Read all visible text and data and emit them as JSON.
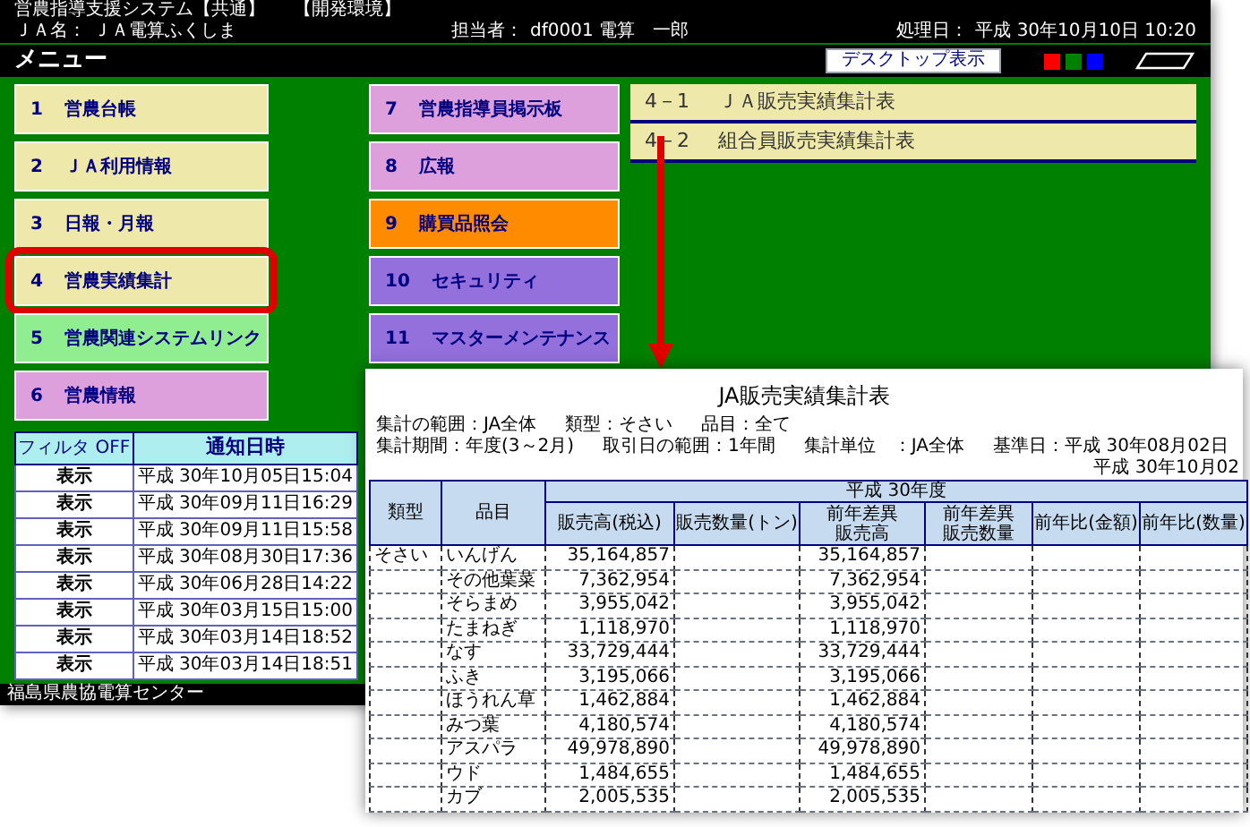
{
  "header": {
    "system_name": "営農指導支援システム【共通】",
    "environment": "【開発環境】",
    "ja_label": "ＪＡ名：",
    "ja_name": "ＪＡ電算ふくしま",
    "staff_label": "担当者：",
    "staff": "df0001 電算　一郎",
    "date_label": "処理日：",
    "date": "平成 30年10月10日 10:20"
  },
  "menu_bar": {
    "title": "メニュー",
    "desktop_button": "デスクトップ表示",
    "swatches": [
      {
        "color": "#ff0000"
      },
      {
        "color": "#008000"
      },
      {
        "color": "#0000ff"
      }
    ]
  },
  "menu": {
    "left_column": [
      {
        "number": "1",
        "label": "営農台帳",
        "color": "#eee8aa",
        "highlighted": false
      },
      {
        "number": "2",
        "label": "ＪＡ利用情報",
        "color": "#eee8aa",
        "highlighted": false
      },
      {
        "number": "3",
        "label": "日報・月報",
        "color": "#eee8aa",
        "highlighted": false
      },
      {
        "number": "4",
        "label": "営農実績集計",
        "color": "#eee8aa",
        "highlighted": true
      },
      {
        "number": "5",
        "label": "営農関連システムリンク",
        "color": "#90ee90",
        "highlighted": false
      },
      {
        "number": "6",
        "label": "営農情報",
        "color": "#dda0dd",
        "highlighted": false
      }
    ],
    "right_column": [
      {
        "number": "7",
        "label": "営農指導員掲示板",
        "color": "#dda0dd",
        "highlighted": false
      },
      {
        "number": "8",
        "label": "広報",
        "color": "#dda0dd",
        "highlighted": false
      },
      {
        "number": "9",
        "label": "購買品照会",
        "color": "#ff8c00",
        "highlighted": false
      },
      {
        "number": "10",
        "label": "セキュリティ",
        "color": "#9370db",
        "highlighted": false
      },
      {
        "number": "11",
        "label": "マスターメンテナンス",
        "color": "#9370db",
        "highlighted": false
      }
    ]
  },
  "submenu": [
    {
      "number": "4－1",
      "label": "ＪＡ販売実績集計表"
    },
    {
      "number": "4－2",
      "label": "組合員販売実績集計表"
    }
  ],
  "notifications": {
    "columns": [
      "フィルタ OFF",
      "通知日時"
    ],
    "rows": [
      {
        "action": "表示",
        "datetime": "平成 30年10月05日15:04"
      },
      {
        "action": "表示",
        "datetime": "平成 30年09月11日16:29"
      },
      {
        "action": "表示",
        "datetime": "平成 30年09月11日15:58"
      },
      {
        "action": "表示",
        "datetime": "平成 30年08月30日17:36"
      },
      {
        "action": "表示",
        "datetime": "平成 30年06月28日14:22"
      },
      {
        "action": "表示",
        "datetime": "平成 30年03月15日15:00"
      },
      {
        "action": "表示",
        "datetime": "平成 30年03月14日18:52"
      },
      {
        "action": "表示",
        "datetime": "平成 30年03月14日18:51"
      }
    ]
  },
  "footer": "福島県農協電算センター",
  "report": {
    "title": "JA販売実績集計表",
    "conditions": [
      [
        "集計の範囲：JA全体",
        "類型：そさい",
        "品目：全て"
      ],
      [
        "集計期間：年度(3～2月)",
        "取引日の範囲：1年間",
        "集計単位　：JA全体",
        "基準日：平成 30年08月02日"
      ]
    ],
    "print_date": "平成 30年10月02",
    "columns": [
      "類型",
      "品目"
    ],
    "group": "平成 30年度",
    "subcolumns": [
      {
        "lines": [
          "販売高(税込)"
        ]
      },
      {
        "lines": [
          "販売数量(トン)"
        ]
      },
      {
        "lines": [
          "前年差異",
          "販売高"
        ]
      },
      {
        "lines": [
          "前年差異",
          "販売数量"
        ]
      },
      {
        "lines": [
          "前年比(金額)"
        ]
      },
      {
        "lines": [
          "前年比(数量)"
        ]
      }
    ],
    "rows": [
      {
        "category": "そさい",
        "item": "いんげん",
        "sales": "35,164,857",
        "prev_diff_sales": "35,164,857"
      },
      {
        "item": "その他葉菜",
        "sales": "7,362,954",
        "prev_diff_sales": "7,362,954"
      },
      {
        "item": "そらまめ",
        "sales": "3,955,042",
        "prev_diff_sales": "3,955,042"
      },
      {
        "item": "たまねぎ",
        "sales": "1,118,970",
        "prev_diff_sales": "1,118,970"
      },
      {
        "item": "なす",
        "sales": "33,729,444",
        "prev_diff_sales": "33,729,444"
      },
      {
        "item": "ふき",
        "sales": "3,195,066",
        "prev_diff_sales": "3,195,066"
      },
      {
        "item": "ほうれん草",
        "sales": "1,462,884",
        "prev_diff_sales": "1,462,884"
      },
      {
        "item": "みつ葉",
        "sales": "4,180,574",
        "prev_diff_sales": "4,180,574"
      },
      {
        "item": "アスパラ",
        "sales": "49,978,890",
        "prev_diff_sales": "49,978,890"
      },
      {
        "item": "ウド",
        "sales": "1,484,655",
        "prev_diff_sales": "1,484,655"
      },
      {
        "item": "カブ",
        "sales": "2,005,535",
        "prev_diff_sales": "2,005,535"
      }
    ]
  }
}
